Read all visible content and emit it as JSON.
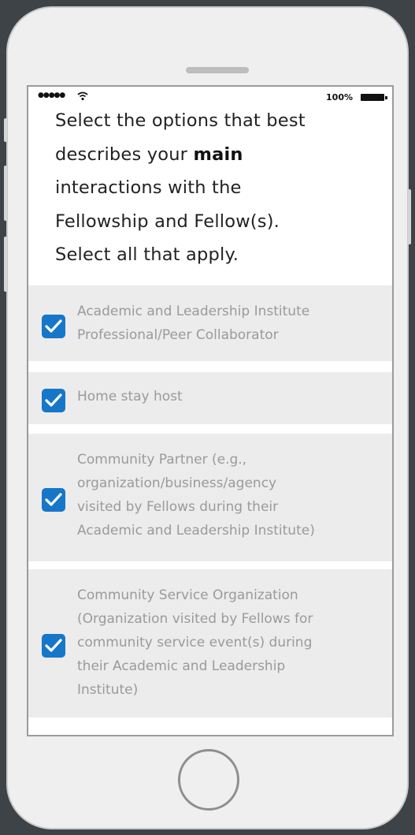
{
  "status_bar": {
    "signal": "●●●●●",
    "battery": "100%"
  },
  "question": {
    "line1": "Select the options that best",
    "line2_prefix": "describes your ",
    "line2_bold": "main",
    "line3": "interactions with the",
    "line4": "Fellowship and Fellow(s).",
    "line5": "Select all that apply."
  },
  "options": [
    {
      "lines": [
        "Academic and Leadership Institute",
        "Professional/Peer Collaborator"
      ],
      "checked": true
    },
    {
      "lines": [
        "Home stay host"
      ],
      "checked": true
    },
    {
      "lines": [
        "Community Partner (e.g.,",
        "organization/business/agency",
        "visited by Fellows during their",
        "Academic and Leadership Institute)"
      ],
      "checked": true
    },
    {
      "lines": [
        "Community Service Organization",
        "(Organization visited by Fellows for",
        "community service event(s) during",
        "their Academic and Leadership",
        "Institute)"
      ],
      "checked": true
    }
  ],
  "colors": {
    "checkbox": "#1677c9",
    "option_bg": "#ececec",
    "option_text": "#9a9a9a"
  }
}
